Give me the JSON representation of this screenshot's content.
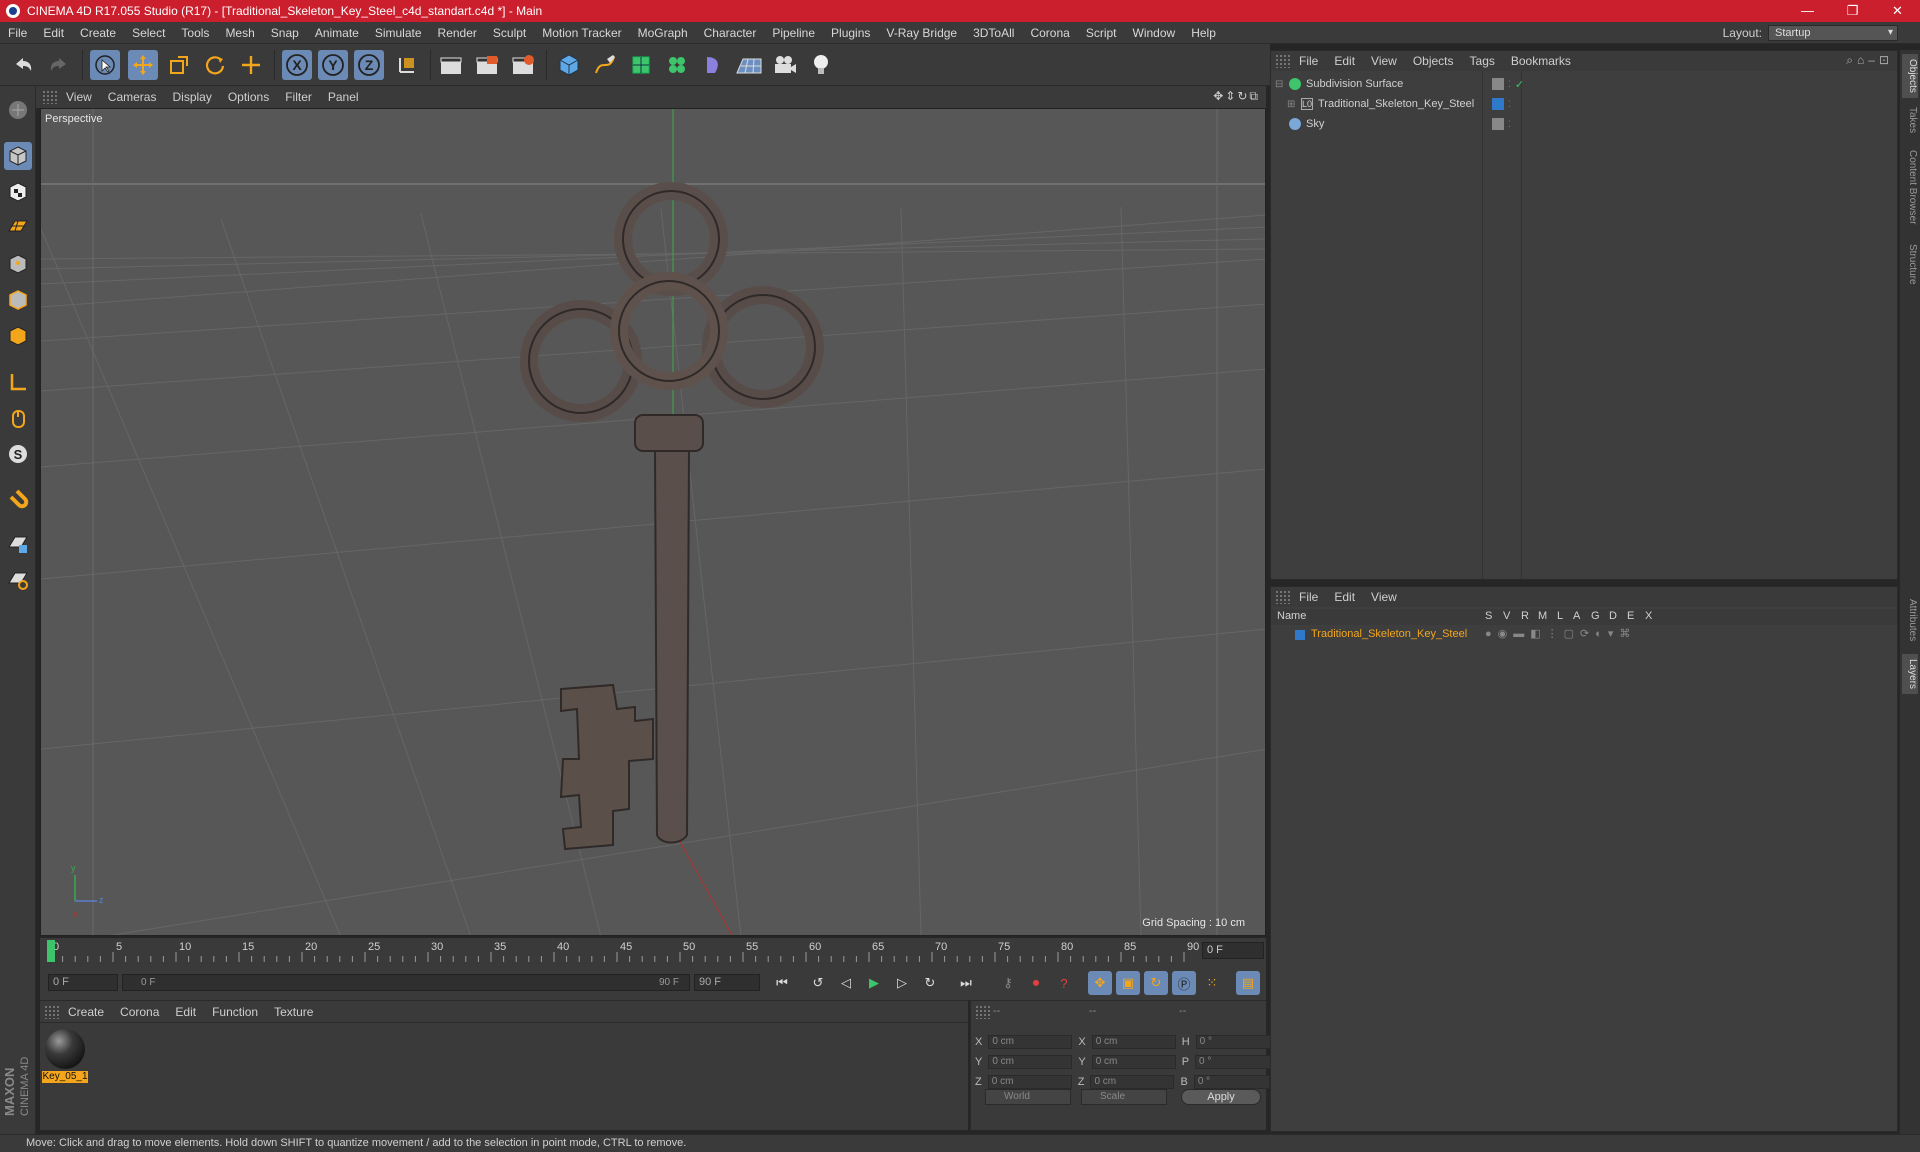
{
  "window": {
    "title": "CINEMA 4D R17.055 Studio (R17) - [Traditional_Skeleton_Key_Steel_c4d_standart.c4d *] - Main",
    "controls": [
      "—",
      "❐",
      "✕"
    ]
  },
  "menubar": {
    "items": [
      "File",
      "Edit",
      "Create",
      "Select",
      "Tools",
      "Mesh",
      "Snap",
      "Animate",
      "Simulate",
      "Render",
      "Sculpt",
      "Motion Tracker",
      "MoGraph",
      "Character",
      "Pipeline",
      "Plugins",
      "V-Ray Bridge",
      "3DToAll",
      "Corona",
      "Script",
      "Window",
      "Help"
    ],
    "layout_label": "Layout:",
    "layout_value": "Startup"
  },
  "toolbar": {
    "axis_labels": [
      "X",
      "Y",
      "Z"
    ]
  },
  "viewport": {
    "menu": [
      "View",
      "Cameras",
      "Display",
      "Options",
      "Filter",
      "Panel"
    ],
    "camera_label": "Perspective",
    "grid_spacing": "Grid Spacing : 10 cm"
  },
  "timeline": {
    "ticks": [
      "0",
      "5",
      "10",
      "15",
      "20",
      "25",
      "30",
      "35",
      "40",
      "45",
      "50",
      "55",
      "60",
      "65",
      "70",
      "75",
      "80",
      "85",
      "90"
    ],
    "current_frame": "0 F"
  },
  "playback": {
    "start_field": "0 F",
    "range_start": "0 F",
    "range_end": "90 F",
    "end_field": "90 F"
  },
  "material_manager": {
    "menu": [
      "Create",
      "Corona",
      "Edit",
      "Function",
      "Texture"
    ],
    "materials": [
      {
        "name": "Key_05_1"
      }
    ]
  },
  "coordinates": {
    "header": [
      "--",
      "--",
      "--"
    ],
    "rows": [
      {
        "axis": "X",
        "pos": "0 cm",
        "axis2": "X",
        "size": "0 cm",
        "rot_label": "H",
        "rot": "0 °"
      },
      {
        "axis": "Y",
        "pos": "0 cm",
        "axis2": "Y",
        "size": "0 cm",
        "rot_label": "P",
        "rot": "0 °"
      },
      {
        "axis": "Z",
        "pos": "0 cm",
        "axis2": "Z",
        "size": "0 cm",
        "rot_label": "B",
        "rot": "0 °"
      }
    ],
    "mode_select": "World",
    "scale_select": "Scale",
    "apply_label": "Apply"
  },
  "object_manager": {
    "menu": [
      "File",
      "Edit",
      "View",
      "Objects",
      "Tags",
      "Bookmarks"
    ],
    "objects": [
      {
        "name": "Subdivision Surface",
        "icon": "subdivision-icon"
      },
      {
        "name": "Traditional_Skeleton_Key_Steel",
        "icon": "null-object-icon"
      },
      {
        "name": "Sky",
        "icon": "sky-icon"
      }
    ]
  },
  "layer_manager": {
    "menu": [
      "File",
      "Edit",
      "View"
    ],
    "columns": [
      "Name",
      "S",
      "V",
      "R",
      "M",
      "L",
      "A",
      "G",
      "D",
      "E",
      "X"
    ],
    "layers": [
      {
        "name": "Traditional_Skeleton_Key_Steel",
        "color": "#2e79c9"
      }
    ]
  },
  "right_tabs": [
    "Objects",
    "Takes",
    "Content Browser",
    "Structure",
    "Attributes",
    "Layers"
  ],
  "status": {
    "text": "Move: Click and drag to move elements. Hold down SHIFT to quantize movement / add to the selection in point mode, CTRL to remove."
  },
  "colors": {
    "title_bar": "#cc1f2e",
    "accent_active": "#6b8ab5",
    "material_highlight": "#f3a61c",
    "layer_name": "#f3a61c"
  }
}
